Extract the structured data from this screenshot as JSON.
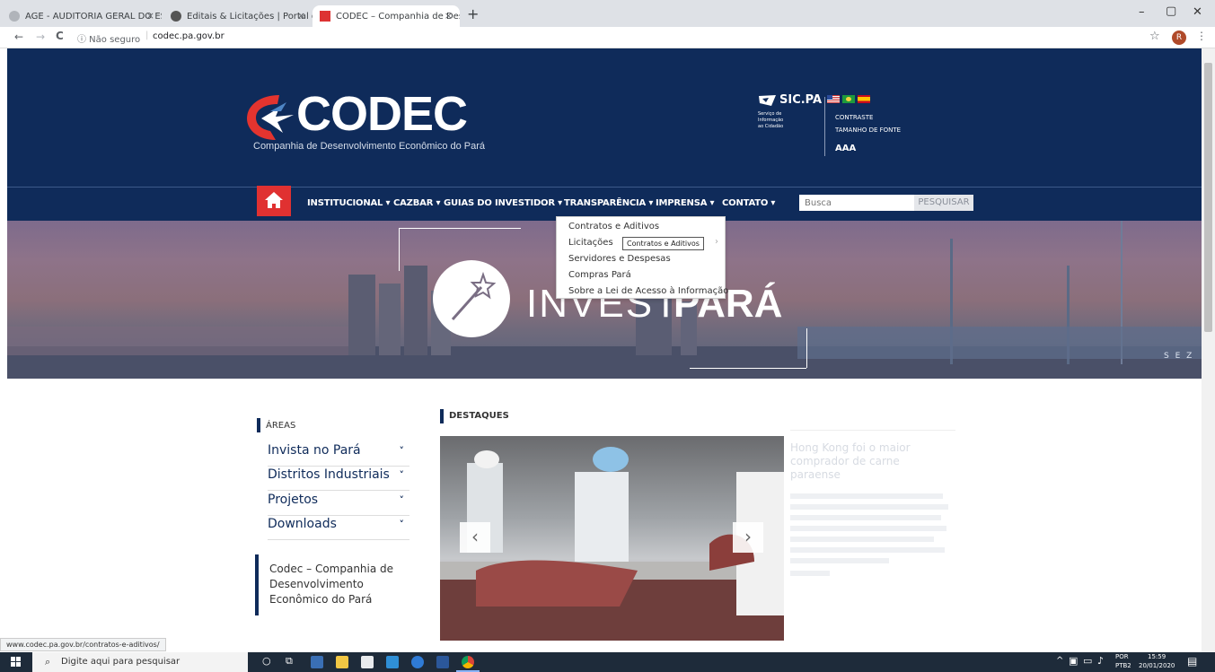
{
  "browser": {
    "tabs": [
      {
        "title": "AGE - AUDITORIA GERAL DO EST",
        "close": "×",
        "active": false,
        "favicon_color": "#b0b4ba"
      },
      {
        "title": "Editais & Licitações | Portal da Tr",
        "close": "×",
        "active": false,
        "favicon_color": "#555"
      },
      {
        "title": "CODEC – Companhia de Desenv",
        "close": "×",
        "active": true,
        "favicon_color": "#d33"
      }
    ],
    "new_tab": "+",
    "window_controls": [
      "–",
      "▢",
      "✕"
    ],
    "back": "←",
    "forward": "→",
    "reload": "C",
    "security_label": "ⓘ Não seguro",
    "url": "codec.pa.gov.br",
    "star": "☆",
    "profile_initial": "R",
    "menu": "⋮",
    "status_url": "www.codec.pa.gov.br/contratos-e-aditivos/"
  },
  "site": {
    "logo_text": "CODEC",
    "logo_subtitle": "Companhia de Desenvolvimento Econômico do Pará",
    "sic": {
      "title": "SIC.PA",
      "subtitle_lines": [
        "Serviço de",
        "Informação",
        "ao Cidadão"
      ]
    },
    "accessibility": {
      "contrast": "CONTRASTE",
      "font_size": "TAMANHO DE FONTE",
      "font_controls": "AAA"
    },
    "nav": {
      "home_icon": "home-icon",
      "items": [
        {
          "label": "INSTITUCIONAL ▾"
        },
        {
          "label": "CAZBAR ▾"
        },
        {
          "label": "GUIAS DO INVESTIDOR ▾"
        },
        {
          "label": "TRANSPARÊNCIA ▾"
        },
        {
          "label": "IMPRENSA ▾"
        },
        {
          "label": "CONTATO ▾"
        }
      ],
      "search_placeholder": "Busca",
      "search_button": "PESQUISAR"
    },
    "dropdown": {
      "items": [
        {
          "label": "Contratos e Aditivos"
        },
        {
          "label": "Licitações"
        },
        {
          "label": "Servidores e Despesas"
        },
        {
          "label": "Compras Pará"
        },
        {
          "label": "Sobre a Lei de Acesso à Informação"
        }
      ],
      "tooltip": "Contratos e Aditivos",
      "submenu_arrow": "›"
    },
    "banner": {
      "title_left": "INVEST",
      "title_right": "PARÁ",
      "corner_text": "S E Z"
    },
    "areas": {
      "heading": "ÁREAS",
      "items": [
        {
          "label": "Invista no Pará",
          "chevron": "˅"
        },
        {
          "label": "Distritos Industriais",
          "chevron": "˅"
        },
        {
          "label": "Projetos",
          "chevron": "˅"
        },
        {
          "label": "Downloads",
          "chevron": "˅"
        }
      ],
      "quote": "Codec – Companhia de Desenvolvimento Econômico do Pará"
    },
    "highlights": {
      "heading": "DESTAQUES",
      "prev": "‹",
      "next": "›",
      "story_title": "Hong Kong foi o maior comprador de carne paraense"
    }
  },
  "taskbar": {
    "search_placeholder": "Digite aqui para pesquisar",
    "lang_top": "POR",
    "lang_bottom": "PTB2",
    "time": "15:59",
    "date": "20/01/2020"
  },
  "colors": {
    "header_navy": "#0f2b5a",
    "home_red": "#e03131",
    "logo_red": "#e4342f"
  }
}
